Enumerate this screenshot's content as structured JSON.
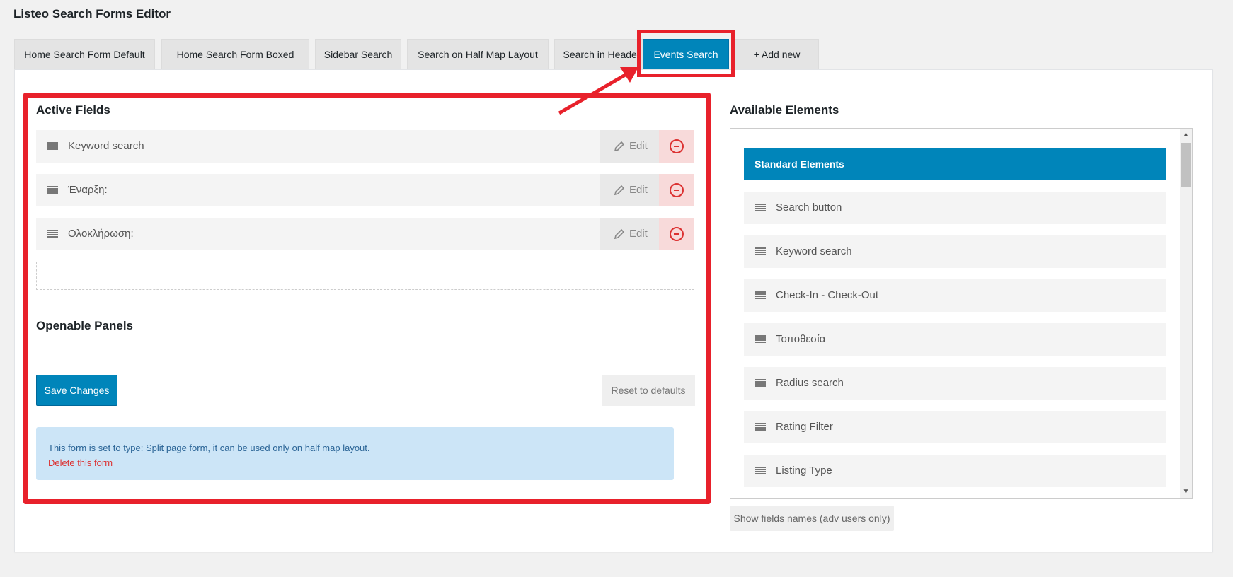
{
  "page": {
    "title": "Listeo Search Forms Editor"
  },
  "tabs": [
    {
      "label": "Home Search Form Default"
    },
    {
      "label": "Home Search Form Boxed"
    },
    {
      "label": "Sidebar Search"
    },
    {
      "label": "Search on Half Map Layout"
    },
    {
      "label": "Search in Header"
    },
    {
      "label": "Events Search",
      "active": true
    },
    {
      "label": "+ Add new"
    }
  ],
  "active_fields": {
    "title": "Active Fields",
    "items": [
      {
        "label": "Keyword search",
        "edit_label": "Edit"
      },
      {
        "label": "Έναρξη:",
        "edit_label": "Edit"
      },
      {
        "label": "Ολοκλήρωση:",
        "edit_label": "Edit"
      }
    ]
  },
  "openable_panels": {
    "title": "Openable Panels"
  },
  "actions": {
    "save_label": "Save Changes",
    "reset_label": "Reset to defaults"
  },
  "notice": {
    "text": "This form is set to type: Split page form, it can be used only on half map layout.",
    "delete_link": "Delete this form"
  },
  "available_elements": {
    "title": "Available Elements",
    "group_header": "Standard Elements",
    "items": [
      {
        "label": "Search button"
      },
      {
        "label": "Keyword search"
      },
      {
        "label": "Check-In - Check-Out"
      },
      {
        "label": "Τοποθεσία"
      },
      {
        "label": "Radius search"
      },
      {
        "label": "Rating Filter"
      },
      {
        "label": "Listing Type"
      }
    ],
    "show_names_label": "Show fields names (adv users only)"
  },
  "colors": {
    "accent": "#0085ba",
    "highlight": "#e8212b",
    "danger": "#dc3232",
    "notice_bg": "#cce5f7"
  }
}
